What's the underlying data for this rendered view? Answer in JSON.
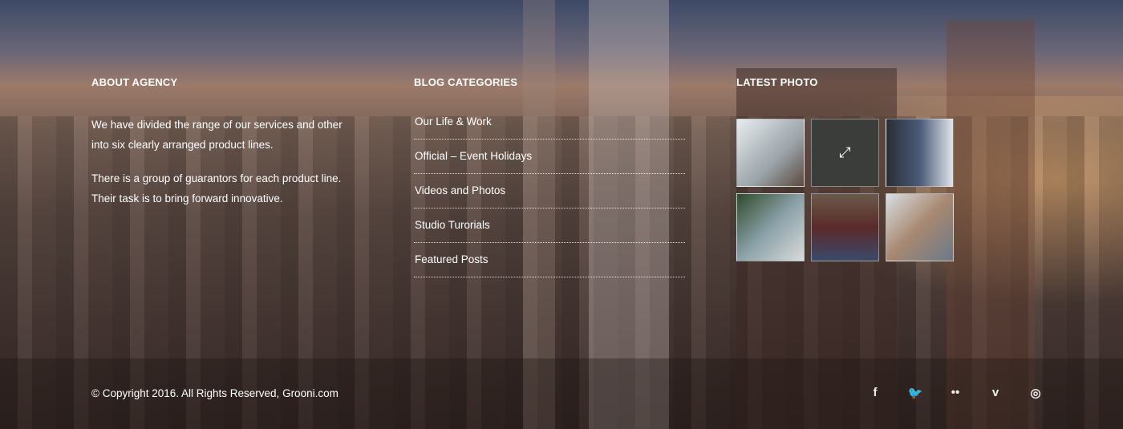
{
  "about": {
    "title": "ABOUT AGENCY",
    "paragraphs": [
      "We have divided the range of our  services and other into six  clearly arranged product lines.",
      "There is a group of guarantors for each  product line. Their task is to bring  forward innovative."
    ]
  },
  "blog": {
    "title": "BLOG CATEGORIES",
    "items": [
      "Our Life & Work",
      "Official  –  Event Holidays",
      "Videos and Photos",
      "Studio Turorials",
      "Featured Posts"
    ]
  },
  "photos": {
    "title": "LATEST PHOTO",
    "expand_icon": "expand-icon"
  },
  "footer": {
    "copyright": "© Copyright 2016. All Rights Reserved, Grooni.com",
    "social": [
      {
        "name": "facebook",
        "glyph": "f"
      },
      {
        "name": "twitter",
        "glyph": "🐦"
      },
      {
        "name": "flickr",
        "glyph": "••"
      },
      {
        "name": "vimeo",
        "glyph": "v"
      },
      {
        "name": "dribbble",
        "glyph": "◎"
      }
    ]
  }
}
